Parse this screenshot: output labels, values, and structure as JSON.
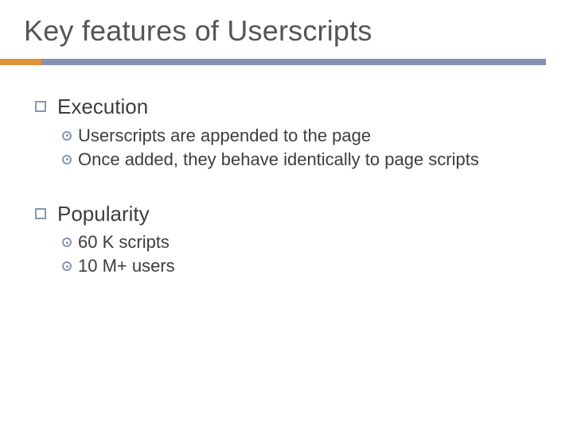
{
  "title": "Key features of Userscripts",
  "sections": [
    {
      "heading": "Execution",
      "items": [
        "Userscripts are appended to the page",
        "Once added, they behave identically to page scripts"
      ]
    },
    {
      "heading": "Popularity",
      "items": [
        "60 K scripts",
        "10 M+ users"
      ]
    }
  ]
}
